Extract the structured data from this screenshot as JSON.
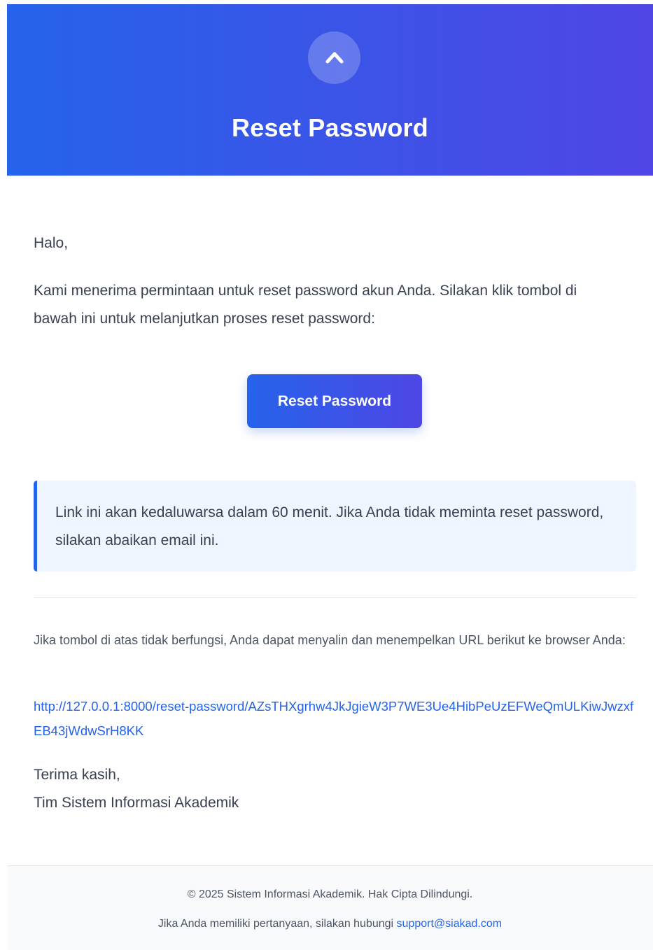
{
  "header": {
    "logo_icon": "chevron-up-icon",
    "title": "Reset Password"
  },
  "body": {
    "greeting": "Halo,",
    "intro": "Kami menerima permintaan untuk reset password akun Anda. Silakan klik tombol di bawah ini untuk melanjutkan proses reset password:",
    "button_label": "Reset Password",
    "notice": "Link ini akan kedaluwarsa dalam 60 menit. Jika Anda tidak meminta reset password, silakan abaikan email ini.",
    "fallback_text": "Jika tombol di atas tidak berfungsi, Anda dapat menyalin dan menempelkan URL berikut ke browser Anda:",
    "reset_url": "http://127.0.0.1:8000/reset-password/AZsTHXgrhw4JkJgieW3P7WE3Ue4HibPeUzEFWeQmULKiwJwzxfEB43jWdwSrH8KK",
    "signoff_line1": "Terima kasih,",
    "signoff_line2": "Tim Sistem Informasi Akademik"
  },
  "footer": {
    "copyright": "© 2025 Sistem Informasi Akademik. Hak Cipta Dilindungi.",
    "contact_prefix": "Jika Anda memiliki pertanyaan, silakan hubungi",
    "contact_email": "support@siakad.com"
  },
  "colors": {
    "accent_start": "#2563eb",
    "accent_end": "#4f46e5",
    "notice_bg": "#eff6ff",
    "footer_bg": "#f9fafb"
  }
}
